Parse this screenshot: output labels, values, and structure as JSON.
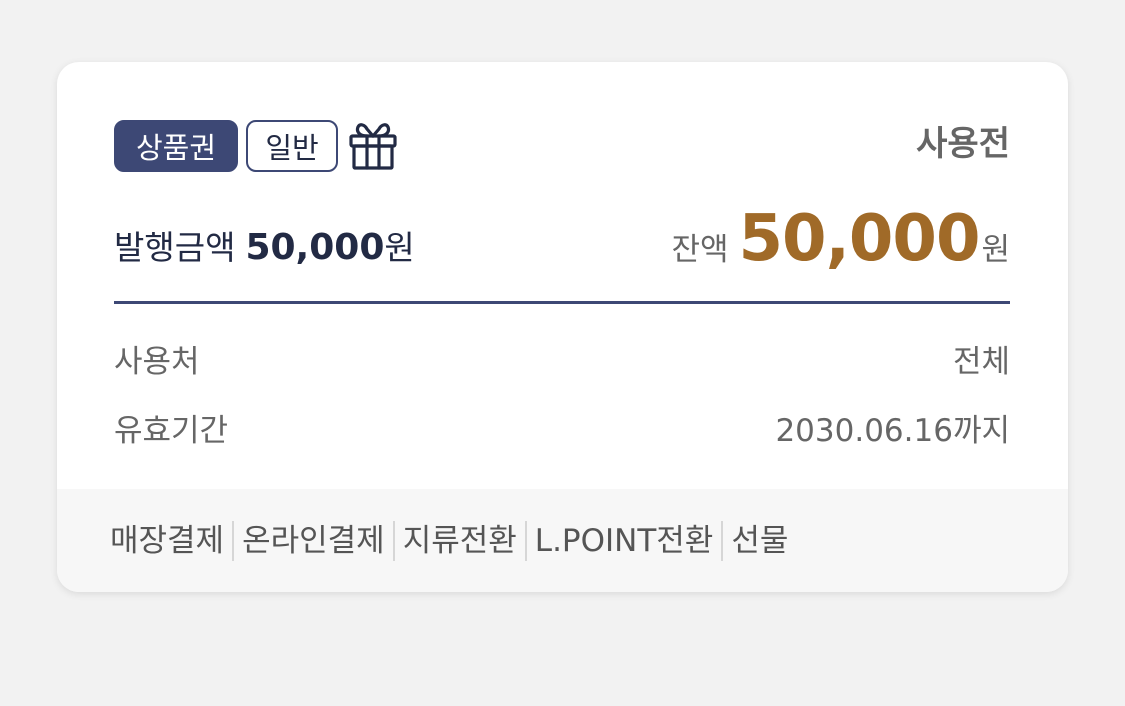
{
  "card": {
    "tags": {
      "type": "상품권",
      "category": "일반"
    },
    "gift_icon": "gift-icon",
    "status": "사용전",
    "issue": {
      "label": "발행금액",
      "amount": "50,000",
      "unit": "원"
    },
    "balance": {
      "label": "잔액",
      "amount": "50,000",
      "unit": "원"
    },
    "details": [
      {
        "label": "사용처",
        "value": "전체"
      },
      {
        "label": "유효기간",
        "value": "2030.06.16까지"
      }
    ],
    "actions": [
      "매장결제",
      "온라인결제",
      "지류전환",
      "L.POINT전환",
      "선물"
    ]
  },
  "colors": {
    "navy": "#3d4875",
    "balance_gold": "#a06a28",
    "background": "#f2f2f2"
  }
}
